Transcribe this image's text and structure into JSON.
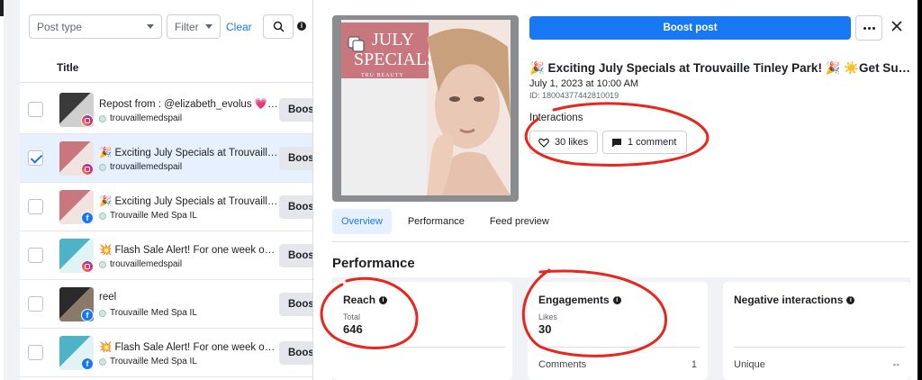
{
  "filters": {
    "post_type_placeholder": "Post type",
    "filter_label": "Filter",
    "clear_label": "Clear"
  },
  "table": {
    "column_title": "Title",
    "boost_label": "Boos",
    "rows": [
      {
        "title": "Repost from : @elizabeth_evolus 💗 \"...",
        "account": "trouvaillemedspail",
        "platform": "instagram",
        "selected": false
      },
      {
        "title": "🎉 Exciting July Specials at Trouvaille ...",
        "account": "trouvaillemedspail",
        "platform": "instagram",
        "selected": true
      },
      {
        "title": "🎉 Exciting July Specials at Trouvaille ...",
        "account": "Trouvaille Med Spa IL",
        "platform": "facebook",
        "selected": false
      },
      {
        "title": "💥 Flash Sale Alert! For one week onl...",
        "account": "trouvaillemedspail",
        "platform": "instagram",
        "selected": false
      },
      {
        "title": "reel",
        "account": "Trouvaille Med Spa IL",
        "platform": "facebook",
        "selected": false
      },
      {
        "title": "💥 Flash Sale Alert! For one week onl...",
        "account": "Trouvaille Med Spa IL",
        "platform": "facebook",
        "selected": false
      }
    ]
  },
  "detail": {
    "preview_headline": "JULY SPECIALS",
    "preview_brand": "TRU BEAUTY",
    "boost_post_label": "Boost post",
    "post_title": "🎉 Exciting July Specials at Trouvaille Tinley Park! 🎉 ☀️Get Sum...",
    "post_date": "July 1, 2023 at 10:00 AM",
    "post_id": "ID: 18004377442810019",
    "interactions_label": "Interactions",
    "likes_label": "30 likes",
    "comments_label": "1 comment",
    "tabs": [
      "Overview",
      "Performance",
      "Feed preview"
    ],
    "active_tab": "Overview",
    "performance_title": "Performance",
    "cards": {
      "reach": {
        "title": "Reach",
        "sub": "Total",
        "value": "646"
      },
      "engagements": {
        "title": "Engagements",
        "sub": "Likes",
        "value": "30",
        "row_label": "Comments",
        "row_value": "1"
      },
      "negative": {
        "title": "Negative interactions",
        "row_label": "Unique",
        "row_value": "--"
      }
    }
  },
  "colors": {
    "accent": "#1877f2",
    "annotation": "#e8261d",
    "selected_row": "#e7f0fe"
  }
}
